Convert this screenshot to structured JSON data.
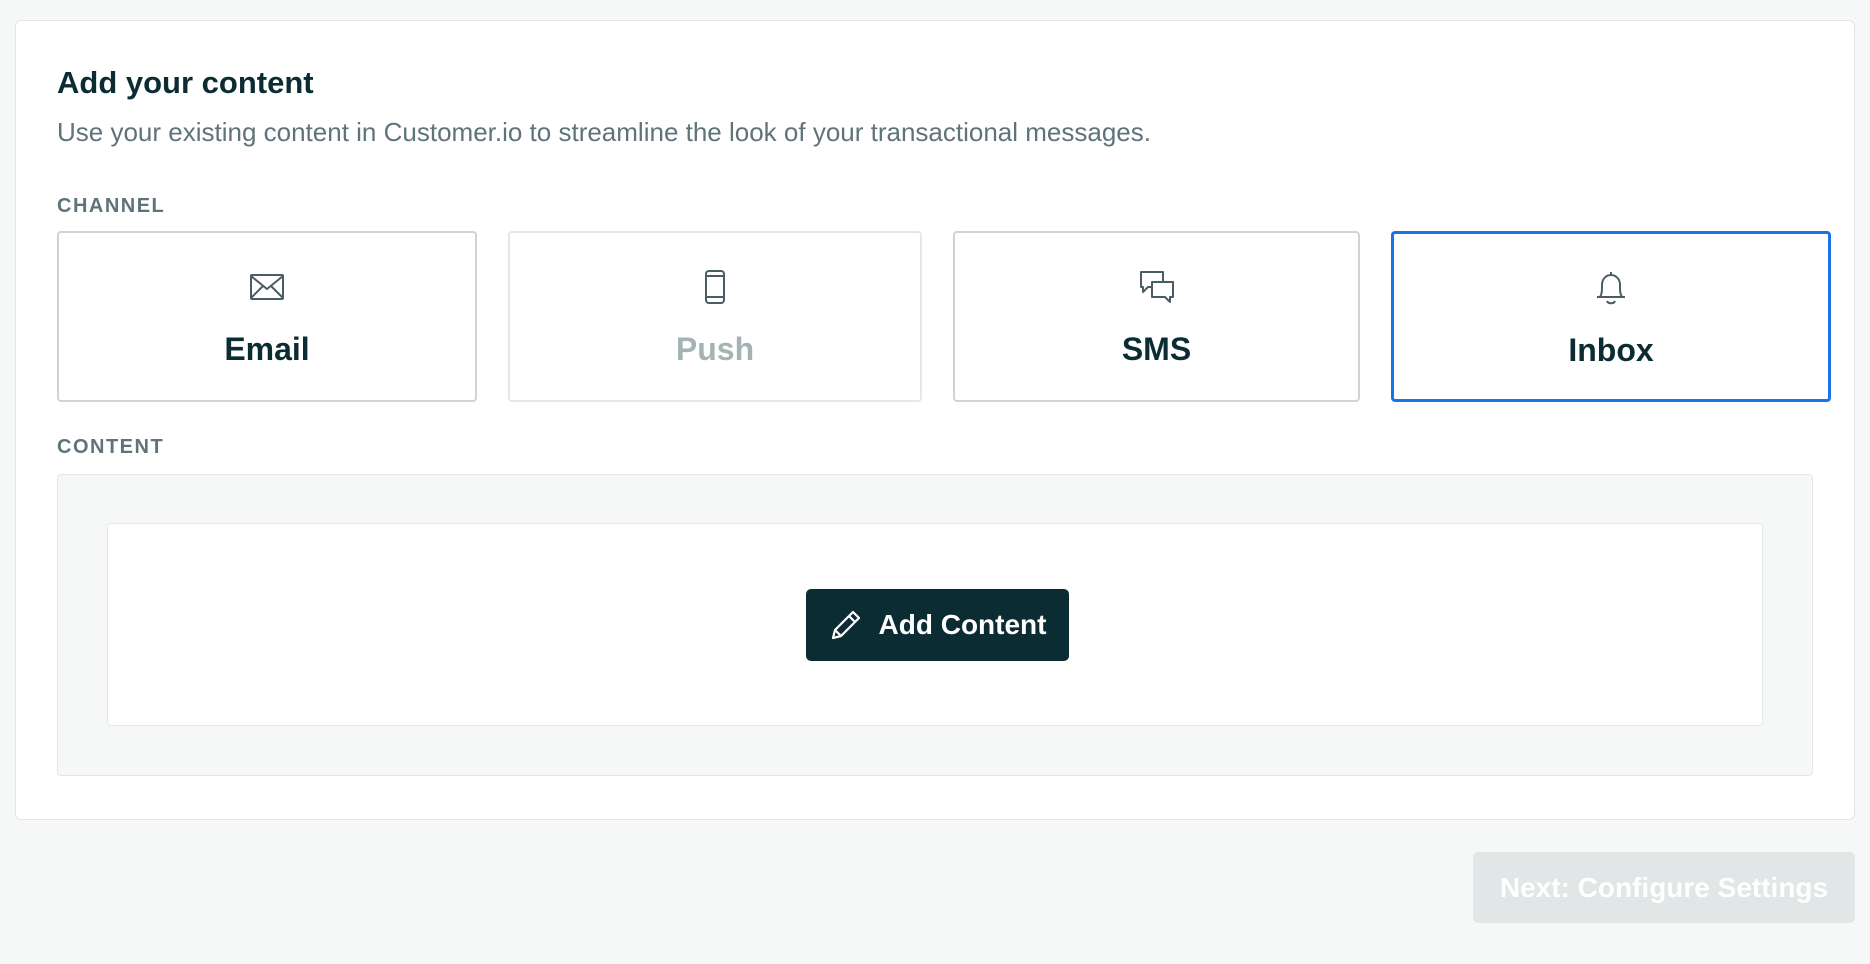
{
  "section": {
    "title": "Add your content",
    "subtitle": "Use your existing content in Customer.io to streamline the look of your transactional messages."
  },
  "channel": {
    "label": "CHANNEL",
    "selected": "Inbox",
    "options": [
      {
        "label": "Email",
        "icon": "envelope-icon",
        "state": "enabled"
      },
      {
        "label": "Push",
        "icon": "mobile-phone-icon",
        "state": "disabled"
      },
      {
        "label": "SMS",
        "icon": "chat-bubbles-icon",
        "state": "enabled"
      },
      {
        "label": "Inbox",
        "icon": "bell-icon",
        "state": "selected"
      }
    ]
  },
  "content": {
    "label": "CONTENT",
    "add_button": {
      "label": "Add Content",
      "icon": "pencil-icon"
    }
  },
  "footer": {
    "next_button": {
      "label": "Next: Configure Settings",
      "state": "disabled"
    }
  },
  "colors": {
    "accent": "#1a73e8",
    "primary_button": "#0c2c33",
    "text_primary": "#0c2c33",
    "text_muted": "#5f7479",
    "disabled_button": "#e1e6e6"
  }
}
